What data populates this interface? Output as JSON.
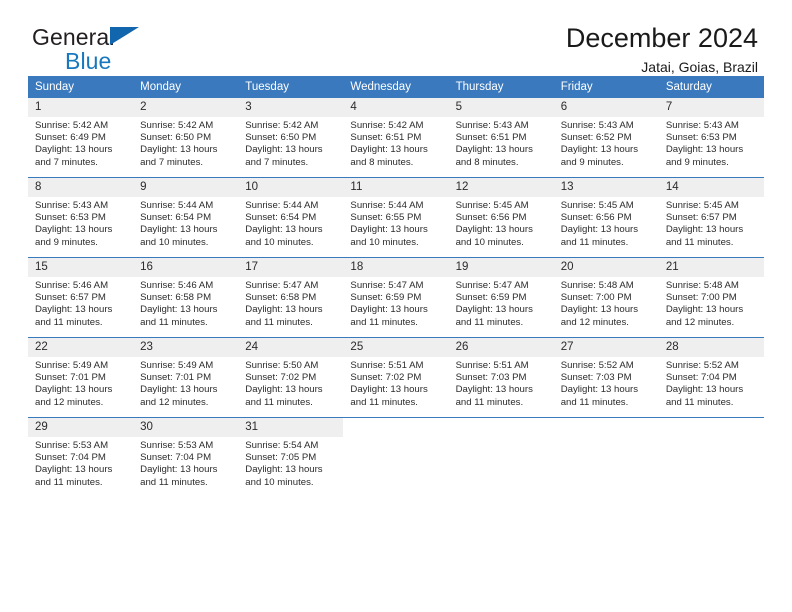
{
  "brand": {
    "name_top": "General",
    "name_bottom": "Blue",
    "accent_color": "#1878be",
    "triangle_color": "#1166ae"
  },
  "header": {
    "title": "December 2024",
    "subtitle": "Jatai, Goias, Brazil",
    "header_bg_color": "#3a79bd",
    "daynum_bg_color": "#efefef"
  },
  "calendar": {
    "weekday_headers": [
      "Sunday",
      "Monday",
      "Tuesday",
      "Wednesday",
      "Thursday",
      "Friday",
      "Saturday"
    ],
    "weeks": [
      [
        {
          "day": "1",
          "sunrise": "Sunrise: 5:42 AM",
          "sunset": "Sunset: 6:49 PM",
          "daylight_1": "Daylight: 13 hours",
          "daylight_2": "and 7 minutes."
        },
        {
          "day": "2",
          "sunrise": "Sunrise: 5:42 AM",
          "sunset": "Sunset: 6:50 PM",
          "daylight_1": "Daylight: 13 hours",
          "daylight_2": "and 7 minutes."
        },
        {
          "day": "3",
          "sunrise": "Sunrise: 5:42 AM",
          "sunset": "Sunset: 6:50 PM",
          "daylight_1": "Daylight: 13 hours",
          "daylight_2": "and 7 minutes."
        },
        {
          "day": "4",
          "sunrise": "Sunrise: 5:42 AM",
          "sunset": "Sunset: 6:51 PM",
          "daylight_1": "Daylight: 13 hours",
          "daylight_2": "and 8 minutes."
        },
        {
          "day": "5",
          "sunrise": "Sunrise: 5:43 AM",
          "sunset": "Sunset: 6:51 PM",
          "daylight_1": "Daylight: 13 hours",
          "daylight_2": "and 8 minutes."
        },
        {
          "day": "6",
          "sunrise": "Sunrise: 5:43 AM",
          "sunset": "Sunset: 6:52 PM",
          "daylight_1": "Daylight: 13 hours",
          "daylight_2": "and 9 minutes."
        },
        {
          "day": "7",
          "sunrise": "Sunrise: 5:43 AM",
          "sunset": "Sunset: 6:53 PM",
          "daylight_1": "Daylight: 13 hours",
          "daylight_2": "and 9 minutes."
        }
      ],
      [
        {
          "day": "8",
          "sunrise": "Sunrise: 5:43 AM",
          "sunset": "Sunset: 6:53 PM",
          "daylight_1": "Daylight: 13 hours",
          "daylight_2": "and 9 minutes."
        },
        {
          "day": "9",
          "sunrise": "Sunrise: 5:44 AM",
          "sunset": "Sunset: 6:54 PM",
          "daylight_1": "Daylight: 13 hours",
          "daylight_2": "and 10 minutes."
        },
        {
          "day": "10",
          "sunrise": "Sunrise: 5:44 AM",
          "sunset": "Sunset: 6:54 PM",
          "daylight_1": "Daylight: 13 hours",
          "daylight_2": "and 10 minutes."
        },
        {
          "day": "11",
          "sunrise": "Sunrise: 5:44 AM",
          "sunset": "Sunset: 6:55 PM",
          "daylight_1": "Daylight: 13 hours",
          "daylight_2": "and 10 minutes."
        },
        {
          "day": "12",
          "sunrise": "Sunrise: 5:45 AM",
          "sunset": "Sunset: 6:56 PM",
          "daylight_1": "Daylight: 13 hours",
          "daylight_2": "and 10 minutes."
        },
        {
          "day": "13",
          "sunrise": "Sunrise: 5:45 AM",
          "sunset": "Sunset: 6:56 PM",
          "daylight_1": "Daylight: 13 hours",
          "daylight_2": "and 11 minutes."
        },
        {
          "day": "14",
          "sunrise": "Sunrise: 5:45 AM",
          "sunset": "Sunset: 6:57 PM",
          "daylight_1": "Daylight: 13 hours",
          "daylight_2": "and 11 minutes."
        }
      ],
      [
        {
          "day": "15",
          "sunrise": "Sunrise: 5:46 AM",
          "sunset": "Sunset: 6:57 PM",
          "daylight_1": "Daylight: 13 hours",
          "daylight_2": "and 11 minutes."
        },
        {
          "day": "16",
          "sunrise": "Sunrise: 5:46 AM",
          "sunset": "Sunset: 6:58 PM",
          "daylight_1": "Daylight: 13 hours",
          "daylight_2": "and 11 minutes."
        },
        {
          "day": "17",
          "sunrise": "Sunrise: 5:47 AM",
          "sunset": "Sunset: 6:58 PM",
          "daylight_1": "Daylight: 13 hours",
          "daylight_2": "and 11 minutes."
        },
        {
          "day": "18",
          "sunrise": "Sunrise: 5:47 AM",
          "sunset": "Sunset: 6:59 PM",
          "daylight_1": "Daylight: 13 hours",
          "daylight_2": "and 11 minutes."
        },
        {
          "day": "19",
          "sunrise": "Sunrise: 5:47 AM",
          "sunset": "Sunset: 6:59 PM",
          "daylight_1": "Daylight: 13 hours",
          "daylight_2": "and 11 minutes."
        },
        {
          "day": "20",
          "sunrise": "Sunrise: 5:48 AM",
          "sunset": "Sunset: 7:00 PM",
          "daylight_1": "Daylight: 13 hours",
          "daylight_2": "and 12 minutes."
        },
        {
          "day": "21",
          "sunrise": "Sunrise: 5:48 AM",
          "sunset": "Sunset: 7:00 PM",
          "daylight_1": "Daylight: 13 hours",
          "daylight_2": "and 12 minutes."
        }
      ],
      [
        {
          "day": "22",
          "sunrise": "Sunrise: 5:49 AM",
          "sunset": "Sunset: 7:01 PM",
          "daylight_1": "Daylight: 13 hours",
          "daylight_2": "and 12 minutes."
        },
        {
          "day": "23",
          "sunrise": "Sunrise: 5:49 AM",
          "sunset": "Sunset: 7:01 PM",
          "daylight_1": "Daylight: 13 hours",
          "daylight_2": "and 12 minutes."
        },
        {
          "day": "24",
          "sunrise": "Sunrise: 5:50 AM",
          "sunset": "Sunset: 7:02 PM",
          "daylight_1": "Daylight: 13 hours",
          "daylight_2": "and 11 minutes."
        },
        {
          "day": "25",
          "sunrise": "Sunrise: 5:51 AM",
          "sunset": "Sunset: 7:02 PM",
          "daylight_1": "Daylight: 13 hours",
          "daylight_2": "and 11 minutes."
        },
        {
          "day": "26",
          "sunrise": "Sunrise: 5:51 AM",
          "sunset": "Sunset: 7:03 PM",
          "daylight_1": "Daylight: 13 hours",
          "daylight_2": "and 11 minutes."
        },
        {
          "day": "27",
          "sunrise": "Sunrise: 5:52 AM",
          "sunset": "Sunset: 7:03 PM",
          "daylight_1": "Daylight: 13 hours",
          "daylight_2": "and 11 minutes."
        },
        {
          "day": "28",
          "sunrise": "Sunrise: 5:52 AM",
          "sunset": "Sunset: 7:04 PM",
          "daylight_1": "Daylight: 13 hours",
          "daylight_2": "and 11 minutes."
        }
      ],
      [
        {
          "day": "29",
          "sunrise": "Sunrise: 5:53 AM",
          "sunset": "Sunset: 7:04 PM",
          "daylight_1": "Daylight: 13 hours",
          "daylight_2": "and 11 minutes."
        },
        {
          "day": "30",
          "sunrise": "Sunrise: 5:53 AM",
          "sunset": "Sunset: 7:04 PM",
          "daylight_1": "Daylight: 13 hours",
          "daylight_2": "and 11 minutes."
        },
        {
          "day": "31",
          "sunrise": "Sunrise: 5:54 AM",
          "sunset": "Sunset: 7:05 PM",
          "daylight_1": "Daylight: 13 hours",
          "daylight_2": "and 10 minutes."
        },
        {
          "day": "",
          "sunrise": "",
          "sunset": "",
          "daylight_1": "",
          "daylight_2": ""
        },
        {
          "day": "",
          "sunrise": "",
          "sunset": "",
          "daylight_1": "",
          "daylight_2": ""
        },
        {
          "day": "",
          "sunrise": "",
          "sunset": "",
          "daylight_1": "",
          "daylight_2": ""
        },
        {
          "day": "",
          "sunrise": "",
          "sunset": "",
          "daylight_1": "",
          "daylight_2": ""
        }
      ]
    ]
  }
}
